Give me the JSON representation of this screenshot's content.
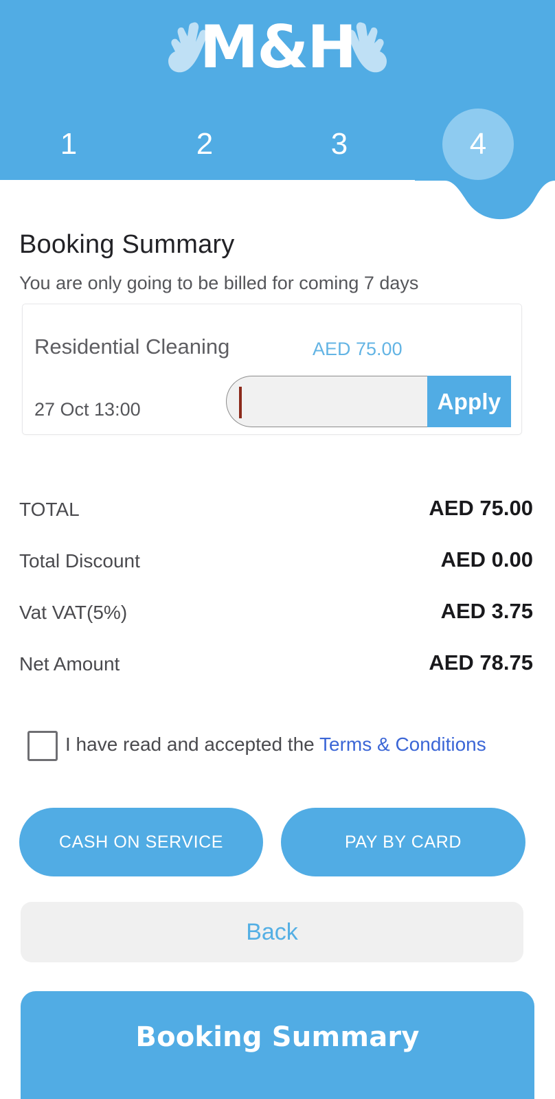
{
  "brand": {
    "logo_text": "M&H",
    "left_icon": "glove-hand-icon",
    "right_icon": "glove-hand-icon",
    "primary_color": "#51ACE4",
    "active_step_color": "#8ECBF0",
    "link_color": "#3B66D6",
    "price_color": "#63B4E4"
  },
  "stepper": {
    "steps": [
      {
        "label": "1",
        "active": false
      },
      {
        "label": "2",
        "active": false
      },
      {
        "label": "3",
        "active": false
      },
      {
        "label": "4",
        "active": true
      }
    ],
    "current": "4"
  },
  "page": {
    "title": "Booking Summary",
    "subtitle": "You are only going to be billed for coming 7 days"
  },
  "service_card": {
    "service_name": "Residential Cleaning",
    "service_price": "AED 75.00",
    "date_time": "27 Oct 13:00",
    "promo_value": "",
    "promo_placeholder": "",
    "apply_label": "Apply"
  },
  "totals": [
    {
      "label": "TOTAL",
      "value": "AED 75.00"
    },
    {
      "label": "Total Discount",
      "value": "AED 0.00"
    },
    {
      "label": "Vat VAT(5%)",
      "value": "AED 3.75"
    },
    {
      "label": "Net Amount",
      "value": "AED 78.75"
    }
  ],
  "terms": {
    "prefix": "I have read and accepted the ",
    "link_label": "Terms & Conditions",
    "checked": false
  },
  "actions": {
    "cash_label": "CASH ON SERVICE",
    "card_label": "PAY BY CARD",
    "back_label": "Back"
  },
  "bottom_bar": {
    "label": "Booking Summary"
  }
}
